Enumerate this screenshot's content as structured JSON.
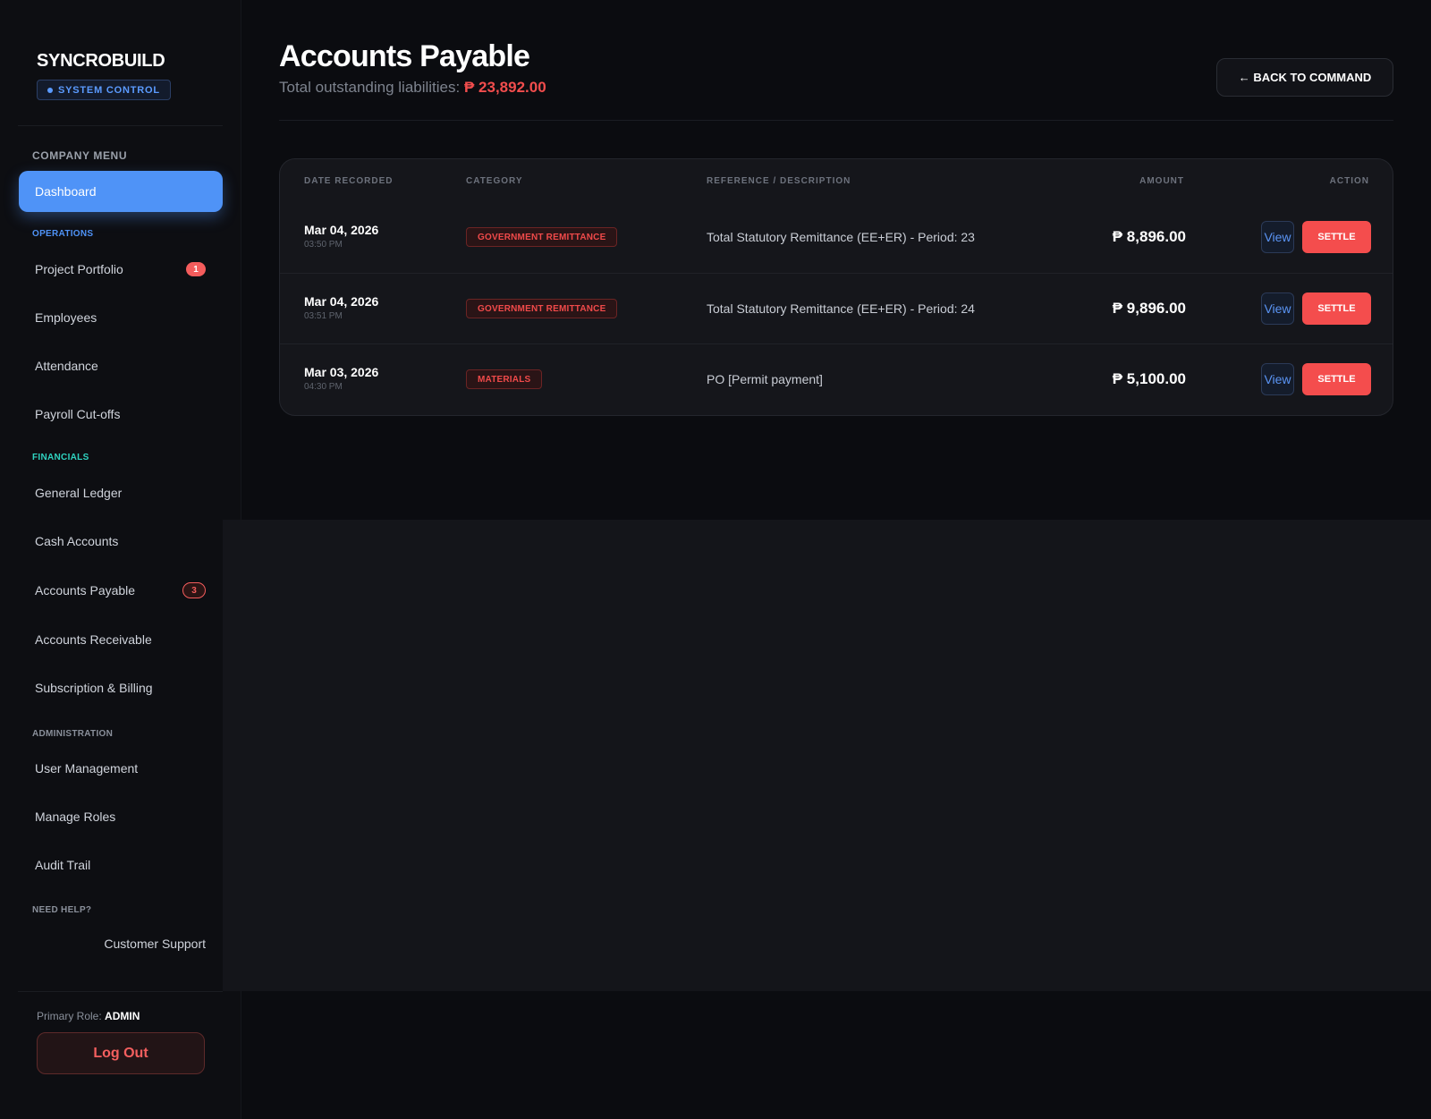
{
  "brand": {
    "name": "SYNCROBUILD",
    "badge": "SYSTEM CONTROL"
  },
  "menu_title": "COMPANY MENU",
  "nav": {
    "dashboard": "Dashboard",
    "operations_label": "OPERATIONS",
    "project_portfolio": "Project Portfolio",
    "project_portfolio_badge": "1",
    "employees": "Employees",
    "attendance": "Attendance",
    "payroll_cutoffs": "Payroll Cut-offs",
    "financials_label": "FINANCIALS",
    "general_ledger": "General Ledger",
    "cash_accounts": "Cash Accounts",
    "accounts_payable": "Accounts Payable",
    "accounts_payable_badge": "3",
    "accounts_receivable": "Accounts Receivable",
    "subscription_billing": "Subscription & Billing",
    "administration_label": "ADMINISTRATION",
    "user_management": "User Management",
    "manage_roles": "Manage Roles",
    "audit_trail": "Audit Trail",
    "help_label": "NEED HELP?",
    "customer_support": "Customer Support"
  },
  "footer": {
    "role_label": "Primary Role:",
    "role_value": "ADMIN",
    "logout": "Log Out"
  },
  "header": {
    "title": "Accounts Payable",
    "subtitle_label": "Total outstanding liabilities:",
    "subtitle_amount": "₱ 23,892.00",
    "back_button": "← BACK TO COMMAND"
  },
  "table": {
    "columns": [
      "DATE RECORDED",
      "CATEGORY",
      "REFERENCE / DESCRIPTION",
      "AMOUNT",
      "ACTION"
    ],
    "rows": [
      {
        "date": "Mar 04, 2026",
        "time": "03:50 PM",
        "category": "GOVERNMENT REMITTANCE",
        "description": "Total Statutory Remittance (EE+ER) - Period: 23",
        "amount": "₱ 8,896.00",
        "view": "View",
        "settle": "SETTLE"
      },
      {
        "date": "Mar 04, 2026",
        "time": "03:51 PM",
        "category": "GOVERNMENT REMITTANCE",
        "description": "Total Statutory Remittance (EE+ER) - Period: 24",
        "amount": "₱ 9,896.00",
        "view": "View",
        "settle": "SETTLE"
      },
      {
        "date": "Mar 03, 2026",
        "time": "04:30 PM",
        "category": "MATERIALS",
        "description": "PO [Permit payment]",
        "amount": "₱ 5,100.00",
        "view": "View",
        "settle": "SETTLE"
      }
    ]
  },
  "colors": {
    "accent": "#4f93f7",
    "danger": "#f44d4d",
    "financials": "#2fd3c0",
    "operations": "#4f93f7"
  }
}
